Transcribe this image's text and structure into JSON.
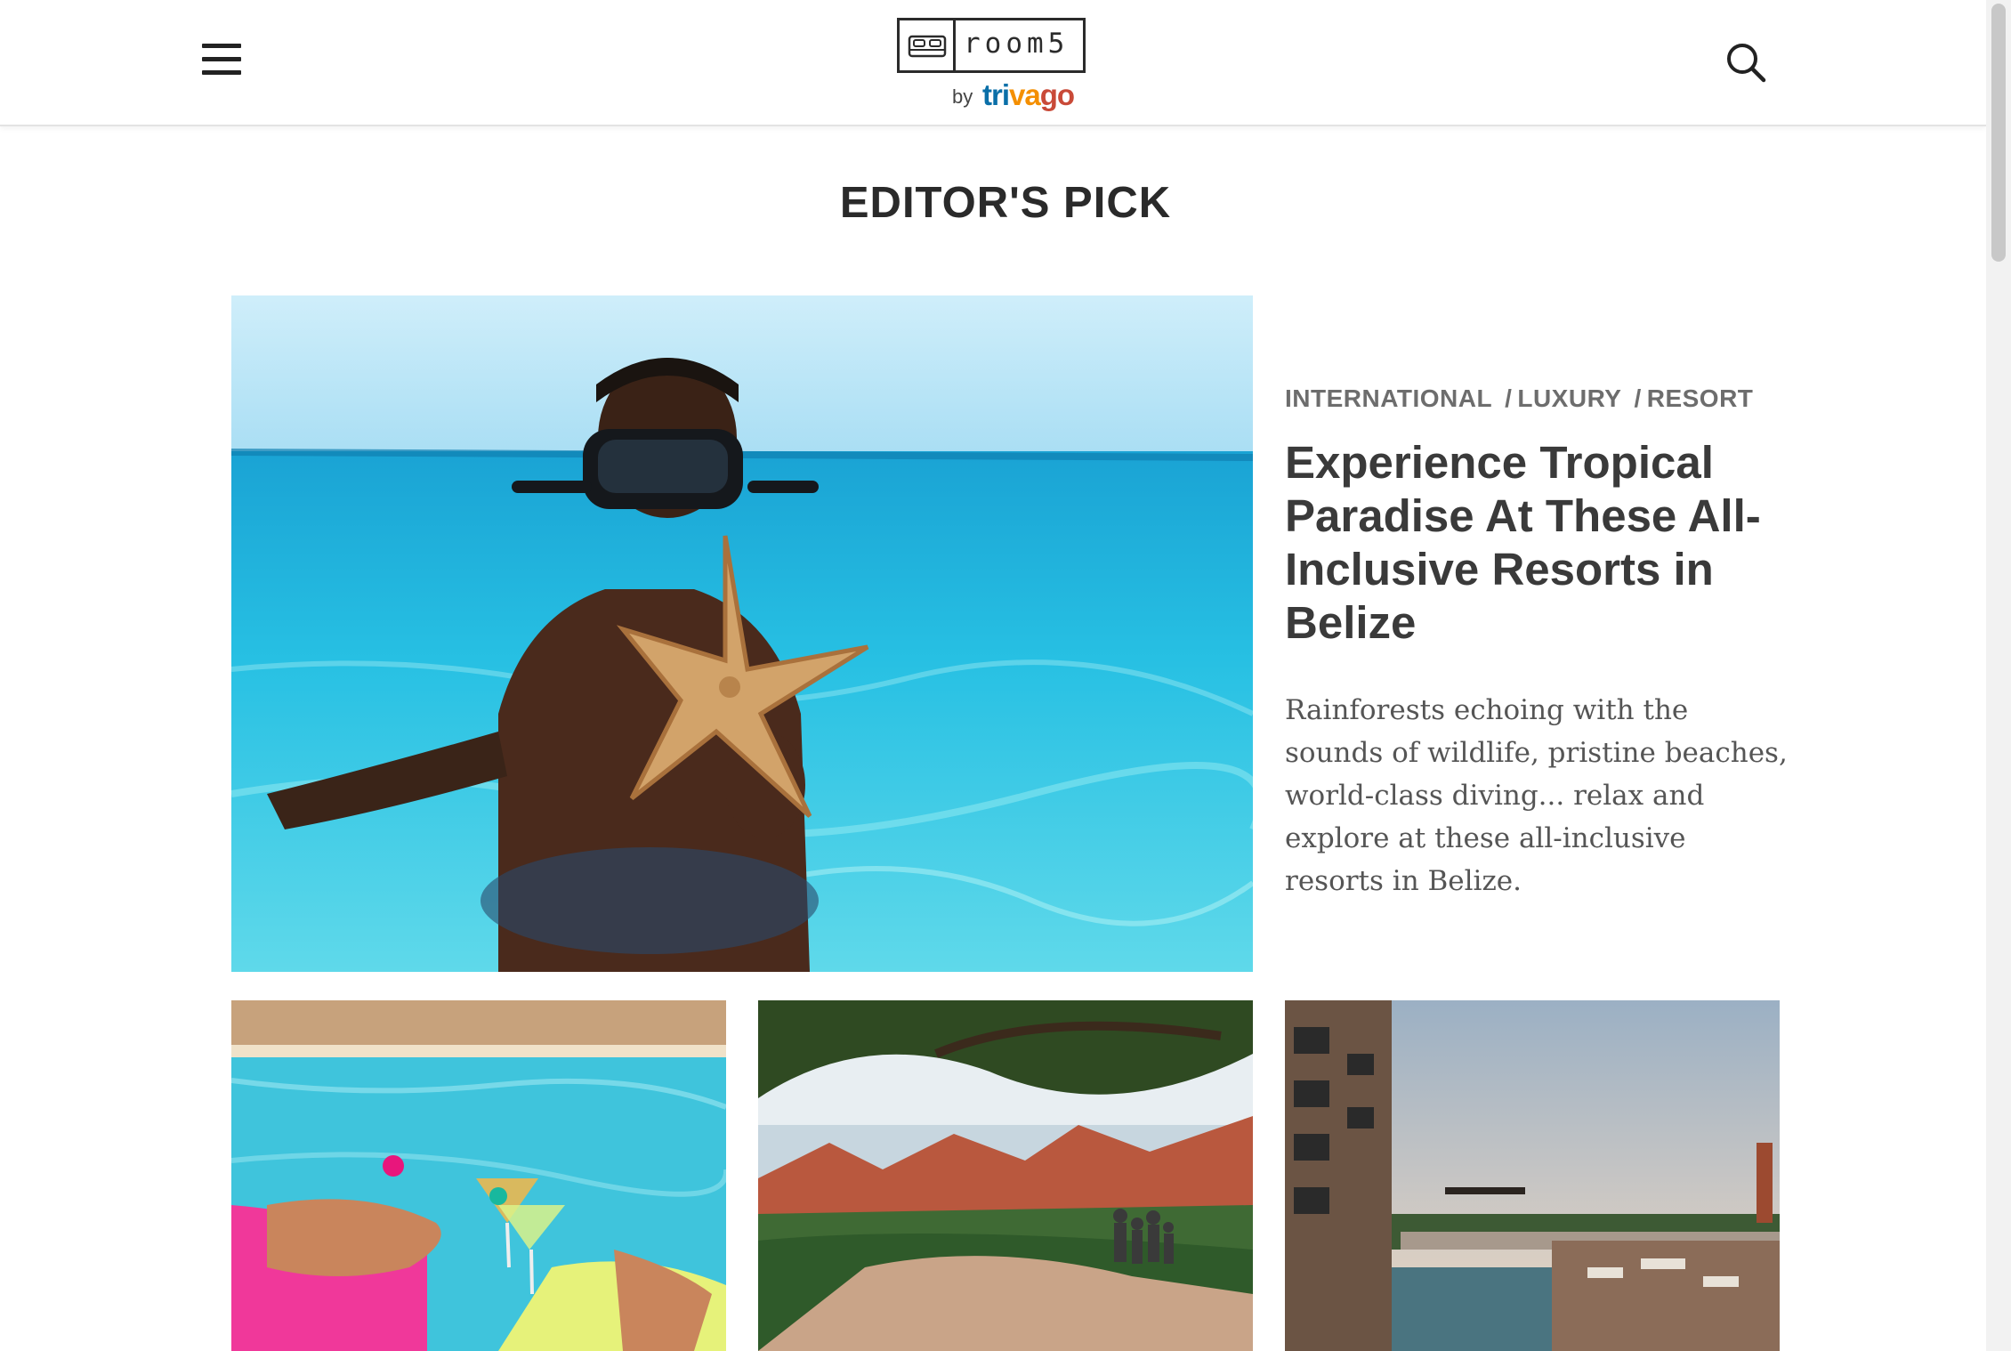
{
  "header": {
    "menu_icon": "hamburger-menu-icon",
    "logo": {
      "wordmark": "room5",
      "by": "by",
      "brand": "trivago",
      "bed_icon": "bed-icon"
    },
    "search_icon": "search-icon"
  },
  "section": {
    "title": "EDITOR'S PICK"
  },
  "featured": {
    "image": "snorkeler-holding-starfish-in-turquoise-sea",
    "tags": [
      "INTERNATIONAL",
      "LUXURY",
      "RESORT"
    ],
    "tag_separator": "/",
    "headline": "Experience Tropical Paradise At These All-Inclusive Resorts in Belize",
    "excerpt": "Rainforests echoing with the sounds of wildlife, pristine beaches, world-class diving... relax and explore at these all-inclusive resorts in Belize."
  },
  "cards": [
    {
      "image": "cocktails-toast-over-pool-with-floats"
    },
    {
      "image": "family-overlooking-red-rock-canyon"
    },
    {
      "image": "rooftop-pool-at-dusk"
    }
  ],
  "colors": {
    "trivago_blue": "#0a6fa8",
    "trivago_orange": "#f48f00",
    "trivago_red": "#c94a38",
    "heading": "#2a2a2a",
    "tag": "#6d6d6d"
  }
}
